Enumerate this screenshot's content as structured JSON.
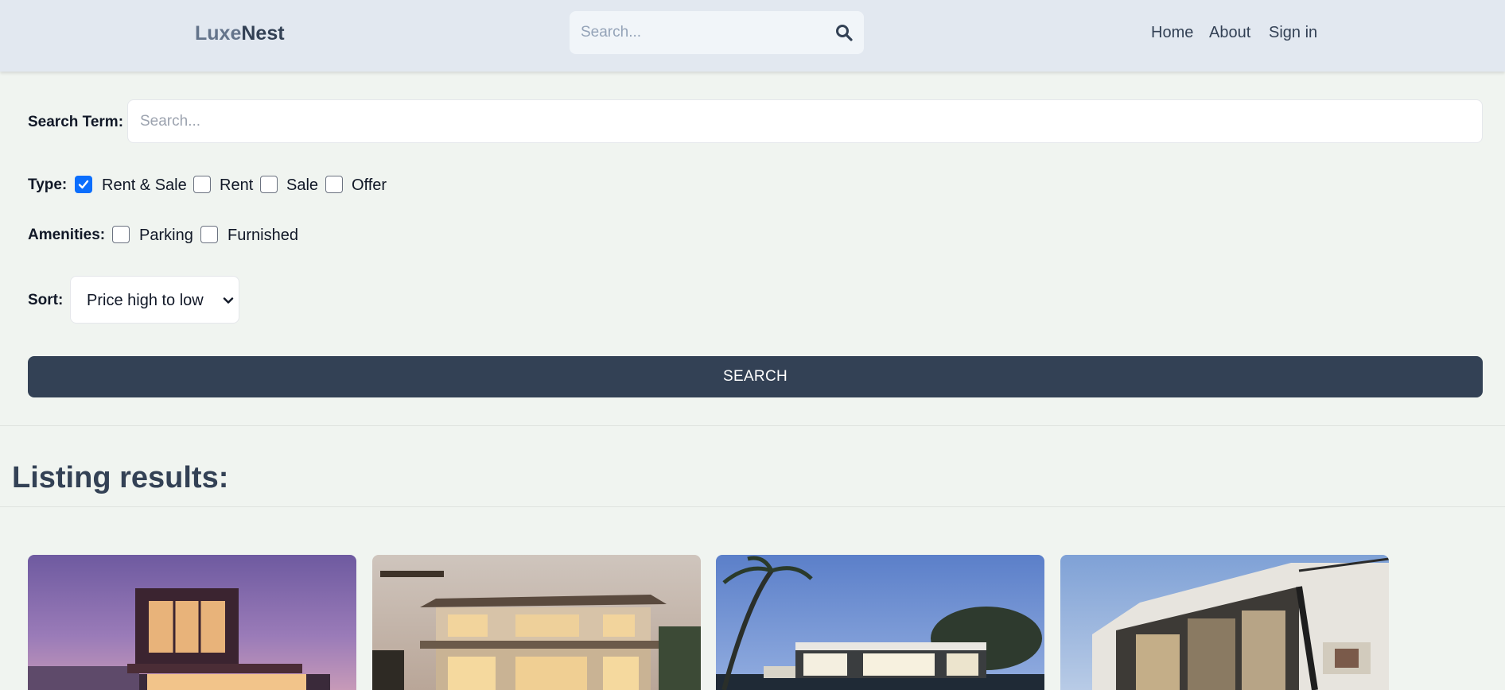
{
  "header": {
    "logo_part1": "Luxe",
    "logo_part2": "Nest",
    "search_placeholder": "Search...",
    "nav": {
      "home": "Home",
      "about": "About",
      "signin": "Sign in"
    }
  },
  "filters": {
    "search_term_label": "Search Term:",
    "search_term_placeholder": "Search...",
    "type_label": "Type:",
    "type_options": [
      {
        "label": "Rent & Sale",
        "checked": true
      },
      {
        "label": "Rent",
        "checked": false
      },
      {
        "label": "Sale",
        "checked": false
      },
      {
        "label": "Offer",
        "checked": false
      }
    ],
    "amenities_label": "Amenities:",
    "amenity_options": [
      {
        "label": "Parking",
        "checked": false
      },
      {
        "label": "Furnished",
        "checked": false
      }
    ],
    "sort_label": "Sort:",
    "sort_value": "Price high to low",
    "search_button": "SEARCH"
  },
  "results": {
    "title": "Listing results:"
  },
  "colors": {
    "accent": "#334155",
    "checkbox_checked": "#0b6efd",
    "page_bg": "#f0f4f0",
    "header_bg": "#e2e8f0"
  }
}
